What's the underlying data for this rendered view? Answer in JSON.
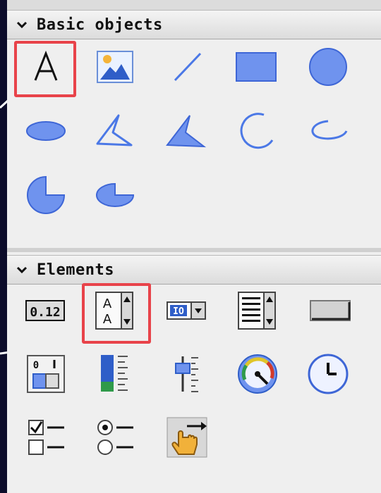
{
  "sections": {
    "basic": {
      "title": "Basic objects"
    },
    "elements": {
      "title": "Elements"
    }
  },
  "elements": {
    "io_field_value": "0.12",
    "text_list_letters": [
      "A",
      "A"
    ],
    "symbolic_io_text": "IO"
  },
  "icons": {
    "basic_objects": [
      "text-field-icon",
      "graphic-view-icon",
      "line-icon",
      "rectangle-icon",
      "circle-icon",
      "ellipse-icon",
      "polygon-icon",
      "polyline-filled-icon",
      "arc-icon",
      "ellipse-arc-icon",
      "circle-segment-icon",
      "ellipse-segment-icon"
    ],
    "elements": [
      "io-field-icon",
      "text-list-icon",
      "symbolic-io-field-icon",
      "list-box-icon",
      "button-icon",
      "switch-icon",
      "bar-icon",
      "slider-icon",
      "gauge-icon",
      "clock-icon",
      "check-box-icon",
      "option-button-icon",
      "hotspot-icon"
    ]
  },
  "colors": {
    "accent_shape": "#4b78e6",
    "highlight": "#e8434a",
    "background": "#0c0c2a"
  }
}
